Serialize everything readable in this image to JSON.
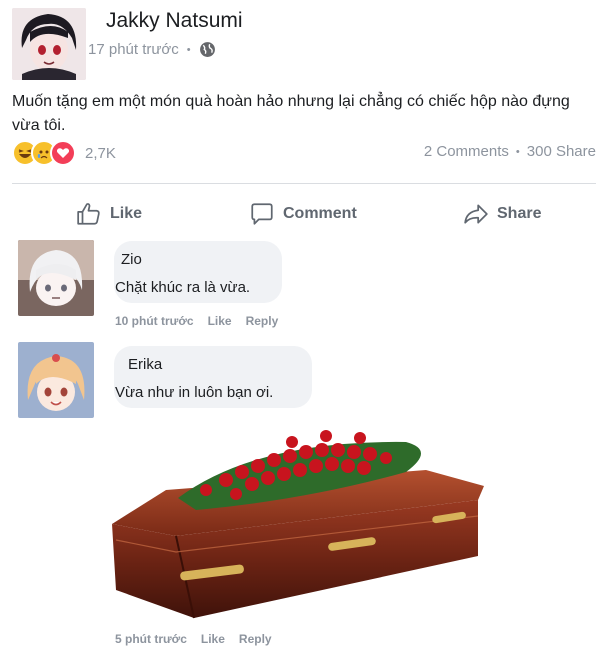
{
  "post": {
    "author": "Jakky Natsumi",
    "time": "17 phút trước",
    "privacy_icon": "globe-icon",
    "text": "Muốn tặng em một món quà hoàn hảo nhưng lại chẳng có chiếc hộp nào đựng vừa tôi.",
    "reaction_count": "2,7K",
    "comments_count": "2 Comments",
    "shares_count": "300 Share",
    "separator": "•"
  },
  "actions": {
    "like": "Like",
    "comment": "Comment",
    "share": "Share"
  },
  "comments": [
    {
      "name": "Zio",
      "text": "Chặt khúc ra là vừa.",
      "time": "10 phút trước",
      "like": "Like",
      "reply": "Reply"
    },
    {
      "name": "Erika",
      "text": "Vừa như in luôn bạn ơi.",
      "time": "5 phút trước",
      "like": "Like",
      "reply": "Reply"
    }
  ],
  "colors": {
    "text": "#1c1e21",
    "meta": "#8d949e",
    "bubble": "#f0f2f5",
    "action": "#606770"
  }
}
